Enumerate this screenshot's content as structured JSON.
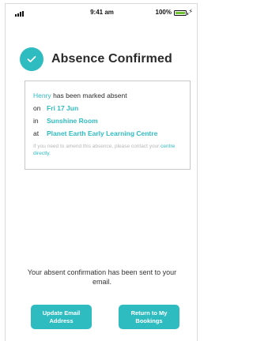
{
  "status_bar": {
    "time": "9:41 am",
    "battery_percent": "100%",
    "battery_level": 1.0,
    "charging_icon": "bolt-icon",
    "signal_icon": "signal-bars-icon"
  },
  "header": {
    "icon": "checkmark-icon",
    "title": "Absence Confirmed"
  },
  "card": {
    "child_name": "Henry",
    "marked_text": "has been marked absent",
    "on_label": "on",
    "date": "Fri 17 Jun",
    "in_label": "in",
    "room": "Sunshine Room",
    "at_label": "at",
    "centre": "Planet Earth Early Learning Centre",
    "note_prefix": "If you need to amend this absence, please contact your",
    "note_link": "centre directly."
  },
  "confirmation_message": "Your absent confirmation has been sent to your email.",
  "buttons": {
    "update_email": "Update Email Address",
    "return_bookings": "Return to My Bookings"
  },
  "colors": {
    "accent": "#2fbcc1",
    "battery": "#6ec531"
  }
}
